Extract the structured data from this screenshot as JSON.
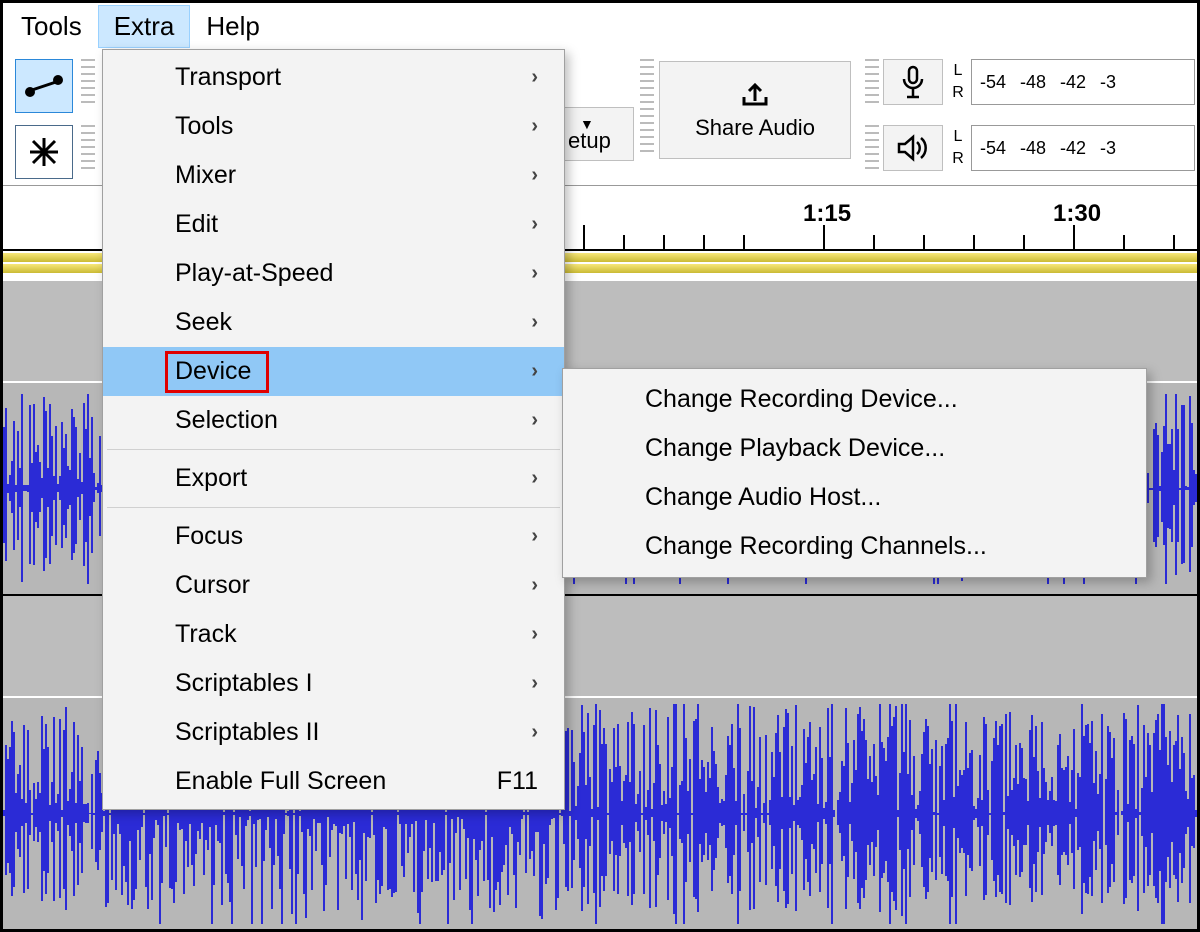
{
  "menubar": {
    "tools": "Tools",
    "extra": "Extra",
    "help": "Help"
  },
  "toolbar": {
    "setup_partial": "etup",
    "share": "Share Audio",
    "levels": {
      "v1": "-54",
      "v2": "-48",
      "v3": "-42",
      "v4": "-3"
    },
    "lr": {
      "l": "L",
      "r": "R"
    }
  },
  "timeline": {
    "t1": "1:15",
    "t2": "1:30"
  },
  "menu": {
    "transport": "Transport",
    "tools": "Tools",
    "mixer": "Mixer",
    "edit": "Edit",
    "play_at_speed": "Play-at-Speed",
    "seek": "Seek",
    "device": "Device",
    "selection": "Selection",
    "export": "Export",
    "focus": "Focus",
    "cursor": "Cursor",
    "track": "Track",
    "scriptables1": "Scriptables I",
    "scriptables2": "Scriptables II",
    "fullscreen": "Enable Full Screen",
    "fullscreen_key": "F11"
  },
  "submenu": {
    "rec_device": "Change Recording Device...",
    "play_device": "Change Playback Device...",
    "audio_host": "Change Audio Host...",
    "rec_channels": "Change Recording Channels..."
  }
}
